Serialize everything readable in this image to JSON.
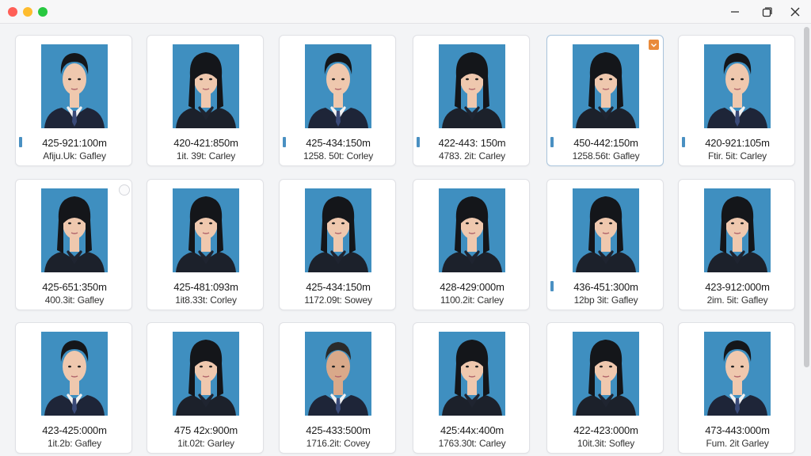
{
  "window": {
    "controls": [
      "minimize-icon",
      "maximize-icon",
      "close-icon"
    ]
  },
  "colors": {
    "photo_background": "#3f8fc0",
    "marker": "#4a90c2",
    "check_badge": "#e98a3a"
  },
  "photos": [
    {
      "line1": "425-921:100m",
      "line2": "Afiju.Uk: Gafley",
      "marker": true,
      "gender": "male"
    },
    {
      "line1": "420-421:850m",
      "line2": "1it. 39t: Carley",
      "marker": false,
      "gender": "female"
    },
    {
      "line1": "425-434:150m",
      "line2": "1258. 50t: Corley",
      "marker": true,
      "gender": "male"
    },
    {
      "line1": "422-443: 150m",
      "line2": "4783. 2it: Carley",
      "marker": true,
      "gender": "female"
    },
    {
      "line1": "450-442:150m",
      "line2": "1258.56t: Gafley",
      "marker": true,
      "gender": "female",
      "selected": true,
      "checked": true
    },
    {
      "line1": "420-921:105m",
      "line2": "Ftir. 5it: Carley",
      "marker": true,
      "gender": "male"
    },
    {
      "line1": "425-651:350m",
      "line2": "400.3it: Gafley",
      "marker": false,
      "gender": "female",
      "radio": true
    },
    {
      "line1": "425-481:093m",
      "line2": "1it8.33t: Corley",
      "marker": false,
      "gender": "female"
    },
    {
      "line1": "425-434:150m",
      "line2": "1172.09t: Sowey",
      "marker": false,
      "gender": "female"
    },
    {
      "line1": "428-429:000m",
      "line2": "1100.2it: Carley",
      "marker": false,
      "gender": "female"
    },
    {
      "line1": "436-451:300m",
      "line2": "12bp 3it: Gafley",
      "marker": true,
      "gender": "female"
    },
    {
      "line1": "423-912:000m",
      "line2": "2im. 5it: Gafley",
      "marker": false,
      "gender": "female"
    },
    {
      "line1": "423-425:000m",
      "line2": "1it.2b: Gafley",
      "marker": false,
      "gender": "male"
    },
    {
      "line1": "475 42x:900m",
      "line2": "1it.02t: Garley",
      "marker": false,
      "gender": "female"
    },
    {
      "line1": "425-433:500m",
      "line2": "1716.2it: Covey",
      "marker": false,
      "gender": "older-male"
    },
    {
      "line1": "425:44x:400m",
      "line2": "1763.30t: Carley",
      "marker": false,
      "gender": "female"
    },
    {
      "line1": "422-423:000m",
      "line2": "10it.3it: Sofley",
      "marker": false,
      "gender": "female"
    },
    {
      "line1": "473-443:000m",
      "line2": "Fum. 2it Garley",
      "marker": false,
      "gender": "male"
    }
  ]
}
